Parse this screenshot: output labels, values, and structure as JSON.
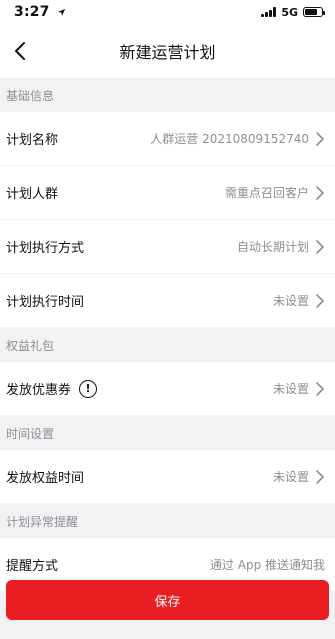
{
  "status_bar": {
    "time": "3:27",
    "network": "5G",
    "battery_level": 0.75
  },
  "nav": {
    "title": "新建运营计划"
  },
  "sections": {
    "basic": {
      "header": "基础信息",
      "rows": [
        {
          "label": "计划名称",
          "value": "人群运营 20210809152740"
        },
        {
          "label": "计划人群",
          "value": "需重点召回客户"
        },
        {
          "label": "计划执行方式",
          "value": "自动长期计划"
        },
        {
          "label": "计划执行时间",
          "value": "未设置"
        }
      ]
    },
    "gift": {
      "header": "权益礼包",
      "rows": [
        {
          "label": "发放优惠券",
          "info_symbol": "!",
          "value": "未设置"
        }
      ]
    },
    "time": {
      "header": "时间设置",
      "rows": [
        {
          "label": "发放权益时间",
          "value": "未设置"
        }
      ]
    },
    "alert": {
      "header": "计划异常提醒",
      "rows": [
        {
          "label": "提醒方式",
          "value": "通过 App 推送通知我"
        }
      ]
    }
  },
  "save_button": {
    "label": "保存"
  },
  "colors": {
    "accent": "#e81e22",
    "muted_text": "#8e8e93",
    "background": "#f2f2f4"
  }
}
